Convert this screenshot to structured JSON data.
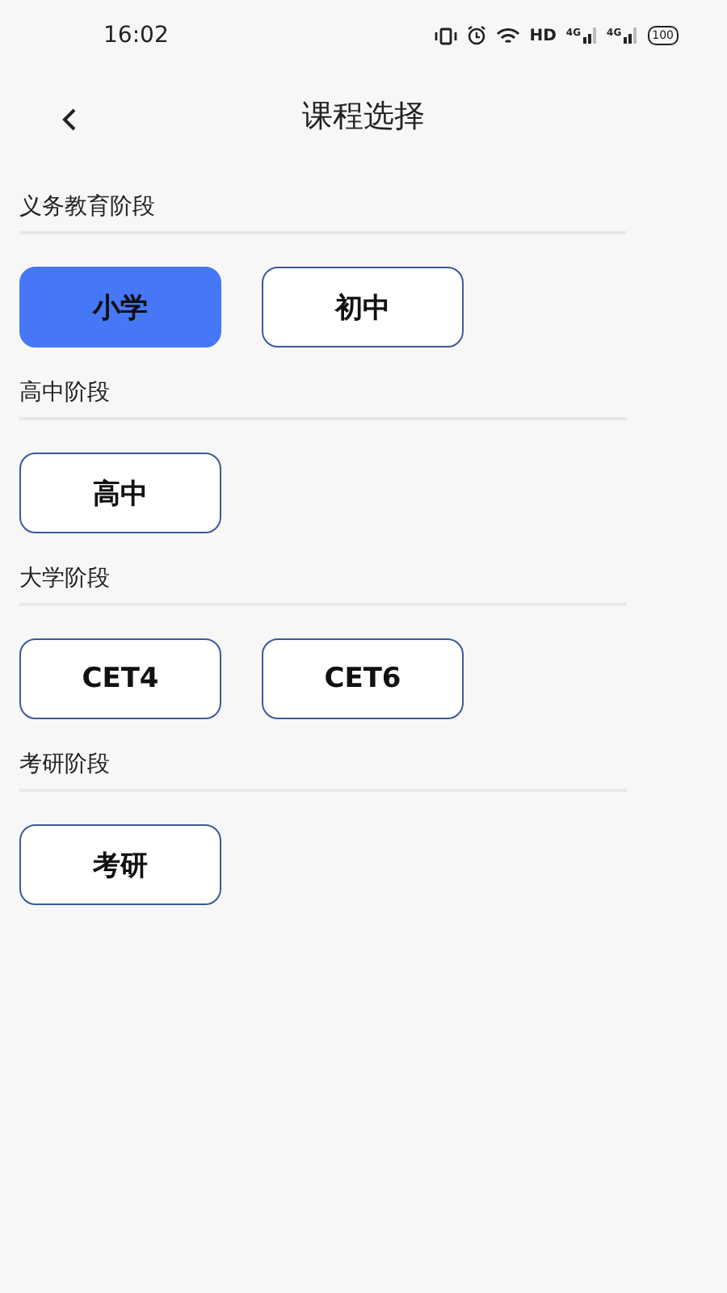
{
  "status_bar": {
    "time": "16:02",
    "hd": "HD",
    "networks": [
      "4G",
      "4G"
    ],
    "battery": "100"
  },
  "header": {
    "title": "课程选择"
  },
  "sections": [
    {
      "title": "义务教育阶段",
      "options": [
        {
          "label": "小学",
          "selected": true
        },
        {
          "label": "初中",
          "selected": false
        }
      ]
    },
    {
      "title": "高中阶段",
      "options": [
        {
          "label": "高中",
          "selected": false
        }
      ]
    },
    {
      "title": "大学阶段",
      "options": [
        {
          "label": "CET4",
          "selected": false
        },
        {
          "label": "CET6",
          "selected": false
        }
      ]
    },
    {
      "title": "考研阶段",
      "options": [
        {
          "label": "考研",
          "selected": false
        }
      ]
    }
  ]
}
